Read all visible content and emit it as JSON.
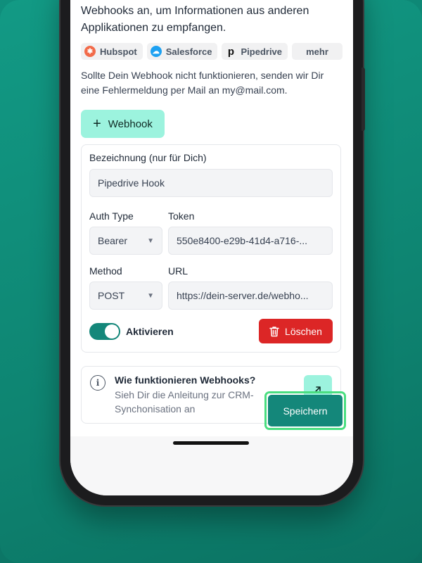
{
  "intro": {
    "line1": "Webhooks an, um Informationen aus anderen",
    "line2": "Applikationen zu empfangen."
  },
  "integrations": [
    {
      "label": "Hubspot",
      "icon": "hubspot-icon"
    },
    {
      "label": "Salesforce",
      "icon": "salesforce-icon"
    },
    {
      "label": "Pipedrive",
      "icon": "pipedrive-icon"
    },
    {
      "label": "mehr"
    }
  ],
  "note": {
    "line1": "Sollte Dein Webhook nicht funktionieren, senden wir Dir",
    "line2": "eine Fehlermeldung per Mail an my@mail.com."
  },
  "add_webhook_label": "Webhook",
  "webhook": {
    "name_label": "Bezeichnung (nur für Dich)",
    "name_value": "Pipedrive Hook",
    "auth_type_label": "Auth Type",
    "auth_type_value": "Bearer",
    "token_label": "Token",
    "token_value": "550e8400-e29b-41d4-a716-...",
    "method_label": "Method",
    "method_value": "POST",
    "url_label": "URL",
    "url_value": "https://dein-server.de/webho...",
    "activate_label": "Aktivieren",
    "activate_on": true,
    "delete_label": "Löschen"
  },
  "help": {
    "title": "Wie funktionieren Webhooks?",
    "desc": "Sieh Dir die Anleitung zur CRM-Synchonisation an"
  },
  "save_label": "Speichern",
  "colors": {
    "accent": "#14877a",
    "accent_light": "#9cf3de",
    "danger": "#dc2626",
    "highlight": "#4ade80"
  }
}
